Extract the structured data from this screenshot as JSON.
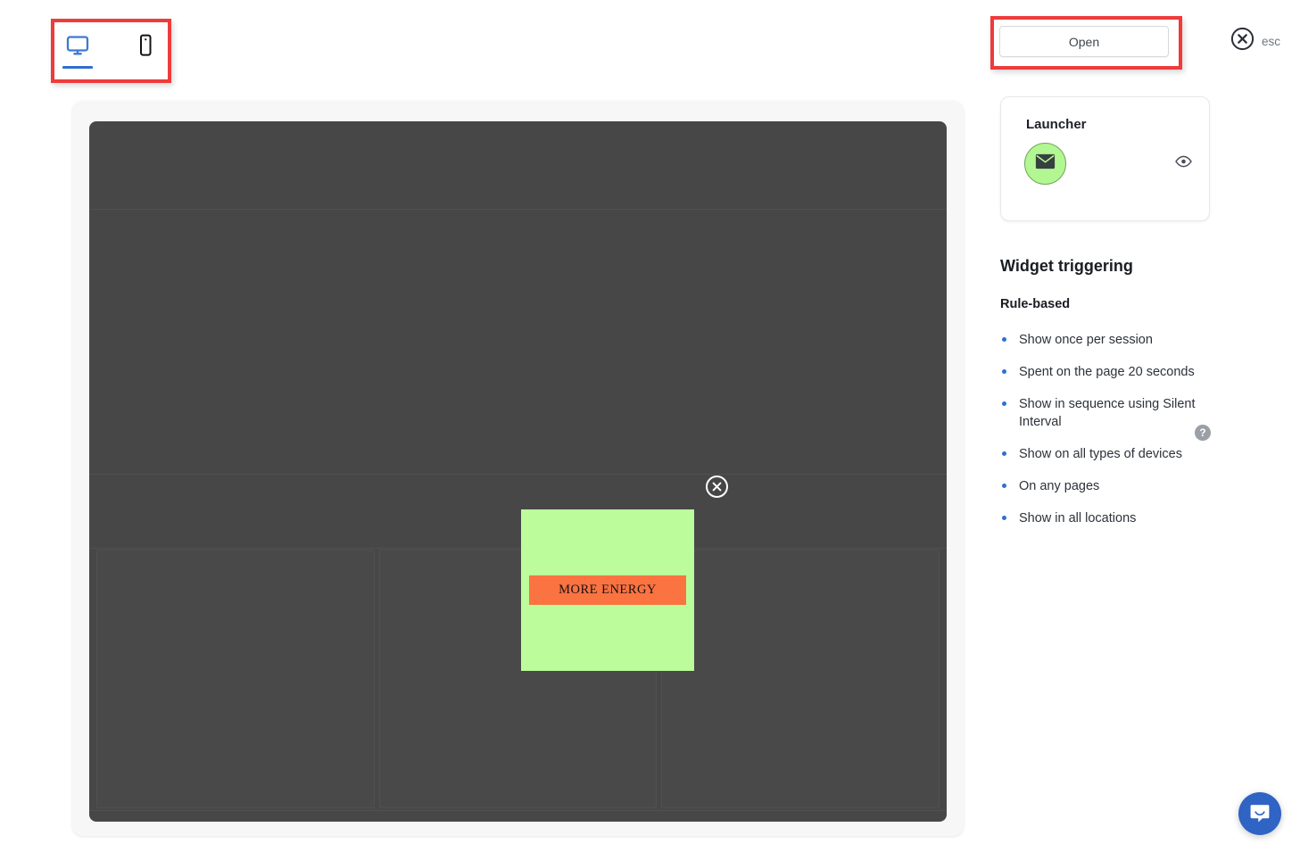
{
  "device_toggle": {
    "options": [
      {
        "name": "desktop",
        "icon": "desktop-monitor-icon",
        "active": true
      },
      {
        "name": "mobile",
        "icon": "mobile-phone-icon",
        "active": false
      }
    ],
    "highlight_color": "#ee3b3b",
    "active_color": "#2f6fce"
  },
  "preview": {
    "mock_background": "#474747",
    "widget": {
      "background_color": "#bcfc9a",
      "cta_label": "MORE ENERGY",
      "cta_background": "#fa7341",
      "close_icon": "circle-x-close-icon"
    }
  },
  "header": {
    "open_label": "Open",
    "esc_label": "esc",
    "close_icon": "circle-x-icon"
  },
  "launcher": {
    "title": "Launcher",
    "avatar_icon": "envelope-icon",
    "avatar_color": "#b2f792",
    "preview_icon": "eye-icon"
  },
  "triggering": {
    "title": "Widget triggering",
    "subtitle": "Rule-based",
    "help_icon": "question-mark-help-icon",
    "rules": [
      "Show once per session",
      "Spent on the page 20 seconds",
      "Show in sequence using Silent Interval",
      "Show on all types of devices",
      "On any pages",
      "Show in all locations"
    ]
  },
  "support": {
    "chat_icon": "intercom-chat-bubble-icon",
    "chat_color": "#2f63c4"
  }
}
